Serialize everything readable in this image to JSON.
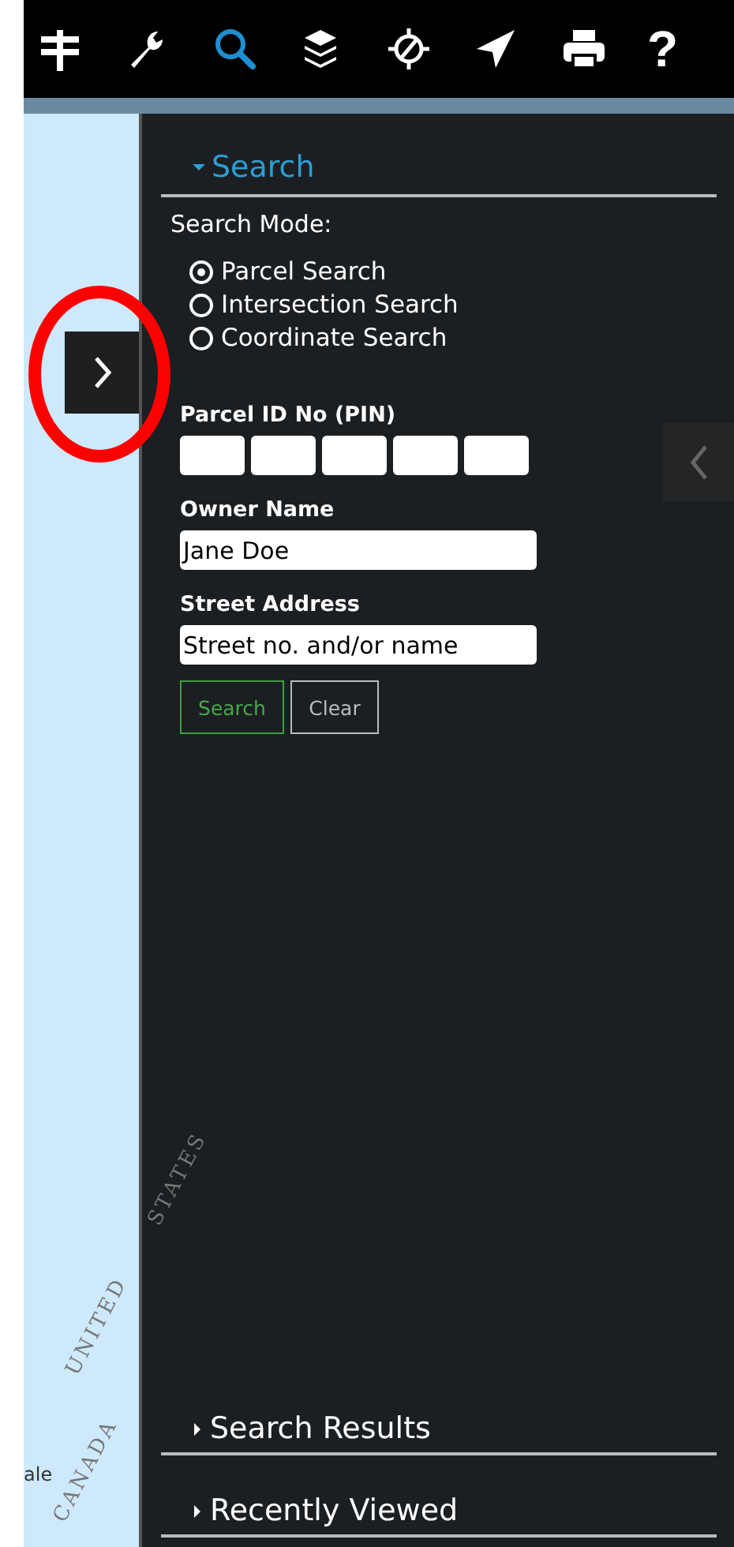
{
  "toolbar": {
    "tools": [
      {
        "selected": false
      },
      {
        "selected": false
      },
      {
        "selected": true
      },
      {
        "selected": false
      },
      {
        "selected": false
      },
      {
        "selected": false
      },
      {
        "selected": false
      },
      {
        "label": "?",
        "selected": false
      }
    ]
  },
  "map": {
    "labels": [
      {
        "text": "UNITED",
        "kind": "border"
      },
      {
        "text": "STATES",
        "kind": "border"
      },
      {
        "text": "CANADA",
        "kind": "border"
      },
      {
        "text": "ale",
        "kind": "place"
      }
    ]
  },
  "search_panel": {
    "title": "Search",
    "expanded": true,
    "mode_label": "Search Mode:",
    "modes": [
      {
        "label": "Parcel Search",
        "selected": true
      },
      {
        "label": "Intersection Search",
        "selected": false
      },
      {
        "label": "Coordinate Search",
        "selected": false
      }
    ],
    "parcel_label": "Parcel ID No (PIN)",
    "owner": {
      "label": "Owner Name",
      "value": "Jane Doe"
    },
    "street": {
      "label": "Street Address",
      "value": "Street no. and/or name"
    },
    "buttons": [
      {
        "label": "Search",
        "kind": "primary"
      },
      {
        "label": "Clear",
        "kind": "secondary"
      }
    ]
  },
  "sections": [
    {
      "title": "Search Results",
      "expanded": false
    },
    {
      "title": "Recently Viewed",
      "expanded": false
    }
  ]
}
